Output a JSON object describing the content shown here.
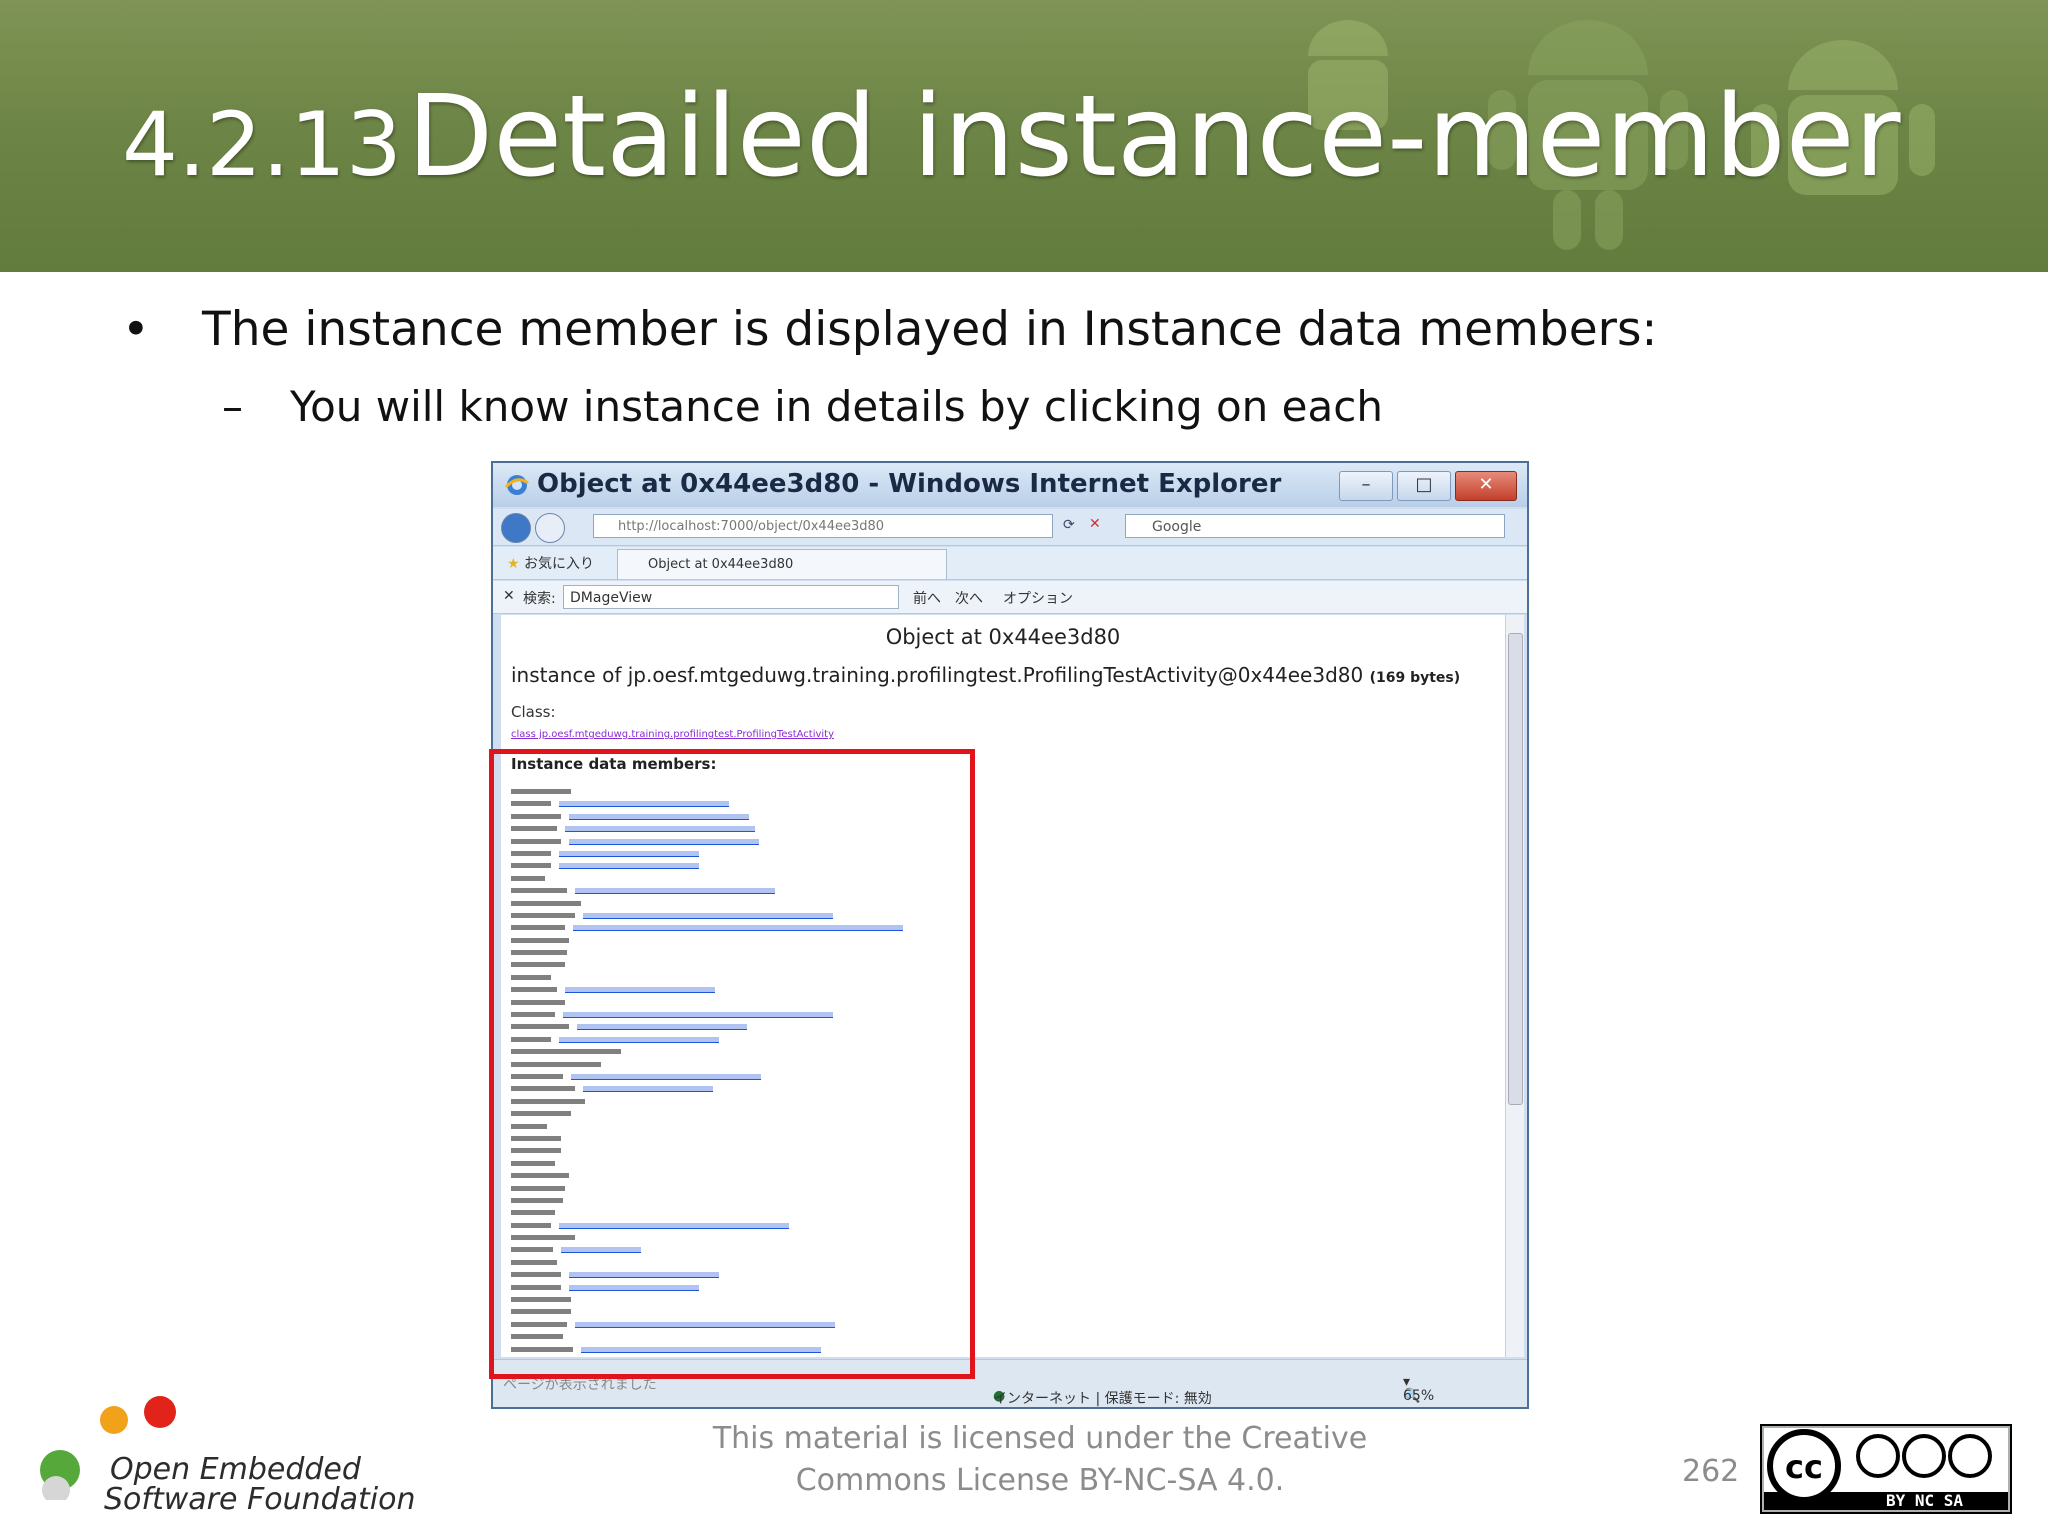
{
  "slide": {
    "title_number": "4.2.13",
    "title_text": "Detailed instance-member",
    "bullet_1": "The instance member is displayed in Instance data members:",
    "bullet_2": "You will know instance in details by clicking on each",
    "footer_text": "This material is licensed under the Creative Commons License BY-NC-SA 4.0.",
    "page_number": "262",
    "logo_line1": "Open Embedded",
    "logo_line2": "Software Foundation",
    "license_badge": "BY NC SA"
  },
  "browser": {
    "window_title": "Object at 0x44ee3d80 - Windows Internet Explorer",
    "address": "http://localhost:7000/object/0x44ee3d80",
    "search_engine": "Google",
    "favorites_label": "お気に入り",
    "tab_label": "Object at 0x44ee3d80",
    "find_label": "検索:",
    "find_value": "DMageView",
    "find_prev": "前へ",
    "find_next": "次へ",
    "options_label": "オプション",
    "page_heading": "Object at 0x44ee3d80",
    "instance_line": "instance of jp.oesf.mtgeduwg.training.profilingtest.ProfilingTestActivity@0x44ee3d80",
    "instance_size": "(169 bytes)",
    "class_label": "Class:",
    "class_link": "class jp.oesf.mtgeduwg.training.profilingtest.ProfilingTestActivity",
    "members_label": "Instance data members:",
    "status_left": "ページが表示されました",
    "status_zone": "インターネット | 保護モード: 無効",
    "zoom": "65%"
  },
  "colors": {
    "header_green": "#6d8546",
    "highlight_red": "#e0141c",
    "link_blue": "#1f55d8"
  }
}
